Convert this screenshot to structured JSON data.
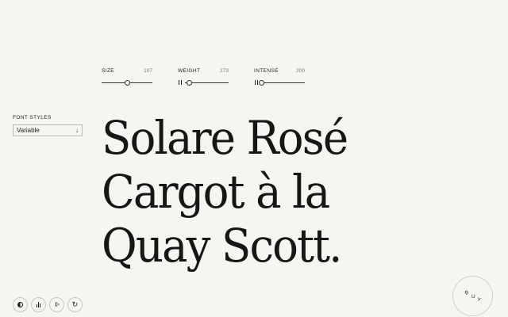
{
  "sliders": [
    {
      "label": "SIZE",
      "value": "107",
      "level": 0.5,
      "paused": false
    },
    {
      "label": "WEIGHT",
      "value": "273",
      "level": 0.1,
      "paused": true
    },
    {
      "label": "INTENSE",
      "value": "200",
      "level": 0.0,
      "paused": true
    }
  ],
  "font_styles": {
    "label": "FONT STYLES",
    "selected": "Variable",
    "icon": "arrow-down-icon"
  },
  "specimen": {
    "lines": [
      "Solare Rosé",
      "Cargot à la",
      "Quay Scott."
    ]
  },
  "controls": [
    {
      "name": "contrast-toggle-button",
      "icon": "contrast-icon"
    },
    {
      "name": "axes-button",
      "icon": "bars-icon"
    },
    {
      "name": "play-button",
      "icon": "play-icon"
    },
    {
      "name": "reset-button",
      "icon": "reset-icon"
    }
  ],
  "buy": {
    "letters": [
      "B",
      "U",
      "Y"
    ]
  },
  "colors": {
    "background": "#f7f5f2",
    "text": "#1a1a1a"
  }
}
